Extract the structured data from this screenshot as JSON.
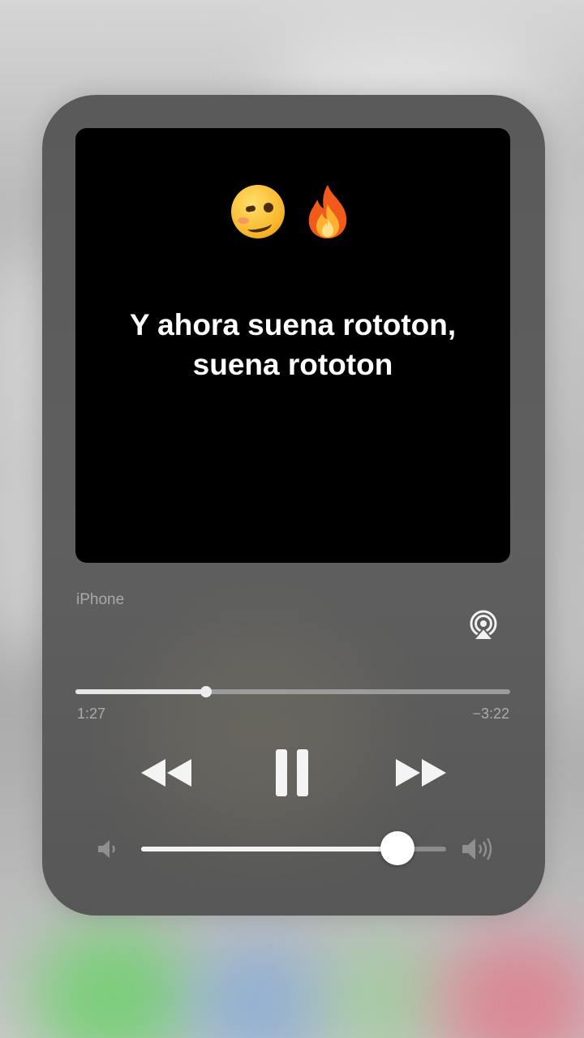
{
  "now_playing": {
    "lyrics": "Y ahora suena rototon,\nsuena rototon",
    "artwork_emojis": [
      "woozy-face-icon",
      "fire-icon"
    ]
  },
  "output": {
    "device_label": "iPhone",
    "airplay_icon": "airplay-icon"
  },
  "playback": {
    "elapsed": "1:27",
    "remaining": "−3:22",
    "progress_fraction": 0.3,
    "state": "playing",
    "controls": [
      "rewind-icon",
      "pause-icon",
      "fast-forward-icon"
    ]
  },
  "volume": {
    "level_fraction": 0.84,
    "icons": [
      "speaker-low-icon",
      "speaker-high-icon"
    ]
  },
  "colors": {
    "artwork_bg": "#000000",
    "card_bg": "#5c5c5c",
    "secondary_text": "#ababab"
  }
}
